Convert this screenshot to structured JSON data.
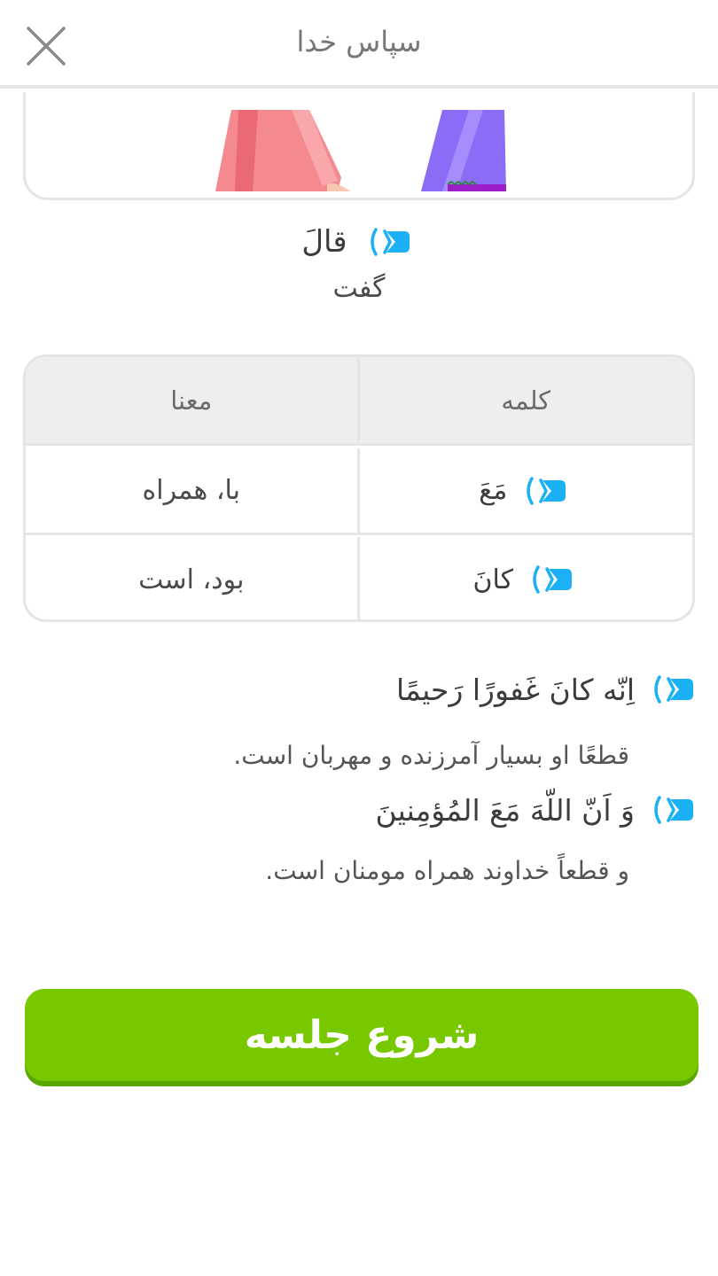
{
  "header": {
    "title": "سپاس خدا"
  },
  "word": {
    "arabic": "قالَ",
    "meaning": "گفت"
  },
  "vocab_table": {
    "headers": {
      "word": "کلمه",
      "meaning": "معنا"
    },
    "rows": [
      {
        "word": "مَعَ",
        "meaning": "با، همراه"
      },
      {
        "word": "کانَ",
        "meaning": "بود، است"
      }
    ]
  },
  "sentences": [
    {
      "arabic": "اِنّه کانَ غَفورًا رَحیمًا",
      "translation": "قطعًا او بسیار آمرزنده و مهربان است."
    },
    {
      "arabic": "وَ اَنّ اللّهَ مَعَ المُؤمِنینَ",
      "translation": "و قطعاً خداوند همراه مومنان است."
    }
  ],
  "start_button": {
    "label": "شروع جلسه"
  },
  "colors": {
    "accent_blue": "#1cb0f6",
    "green": "#78c800",
    "green_shadow": "#58a700",
    "border": "#e5e5e5"
  },
  "icons": {
    "close": "close-icon",
    "speaker": "speaker-icon"
  }
}
